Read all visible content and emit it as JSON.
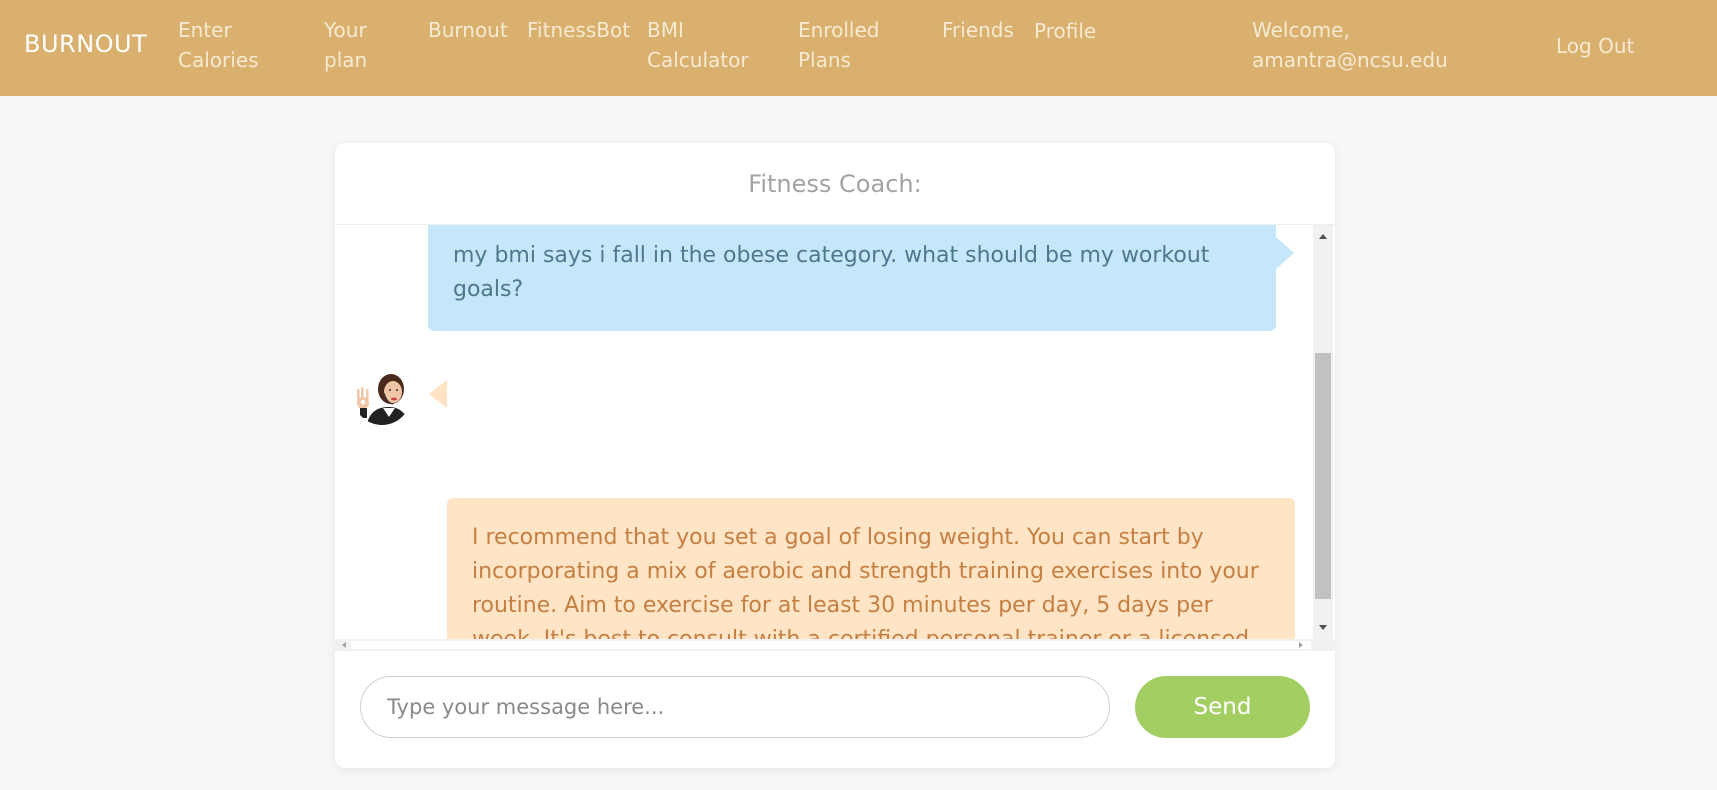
{
  "navbar": {
    "brand": "BURNOUT",
    "links": {
      "enter_calories": "Enter Calories",
      "your_plan": "Your plan",
      "burnout": "Burnout",
      "fitnessbot": "FitnessBot",
      "bmi_calculator": "BMI Calculator",
      "enrolled_plans": "Enrolled Plans",
      "friends": "Friends",
      "profile": "Profile"
    },
    "welcome": "Welcome, amantra@ncsu.edu",
    "logout": "Log Out"
  },
  "chat": {
    "title": "Fitness Coach:",
    "messages": [
      {
        "role": "user",
        "text": "my bmi says i fall in the obese category. what should be my workout goals?"
      },
      {
        "role": "bot",
        "text": "I recommend that you set a goal of losing weight. You can start by incorporating a mix of aerobic and strength training exercises into your routine. Aim to exercise for at least 30 minutes per day, 5 days per week. It's best to consult with a certified personal trainer or a licensed healthcare professional to create a personalized workout plan that suits your needs and abilities. Are there any specific exercises or concerns you would like me to address?"
      }
    ],
    "input_placeholder": "Type your message here...",
    "input_value": "",
    "send_label": "Send"
  },
  "colors": {
    "navbar_bg": "#d9b06d",
    "user_bubble_bg": "#c6e6fa",
    "user_text": "#4e788f",
    "bot_bubble_bg": "#ffe4c6",
    "bot_text": "#c47f42",
    "send_button_bg": "#a3cf62"
  },
  "icons": {
    "avatar": "fitness-coach-avatar-icon"
  }
}
